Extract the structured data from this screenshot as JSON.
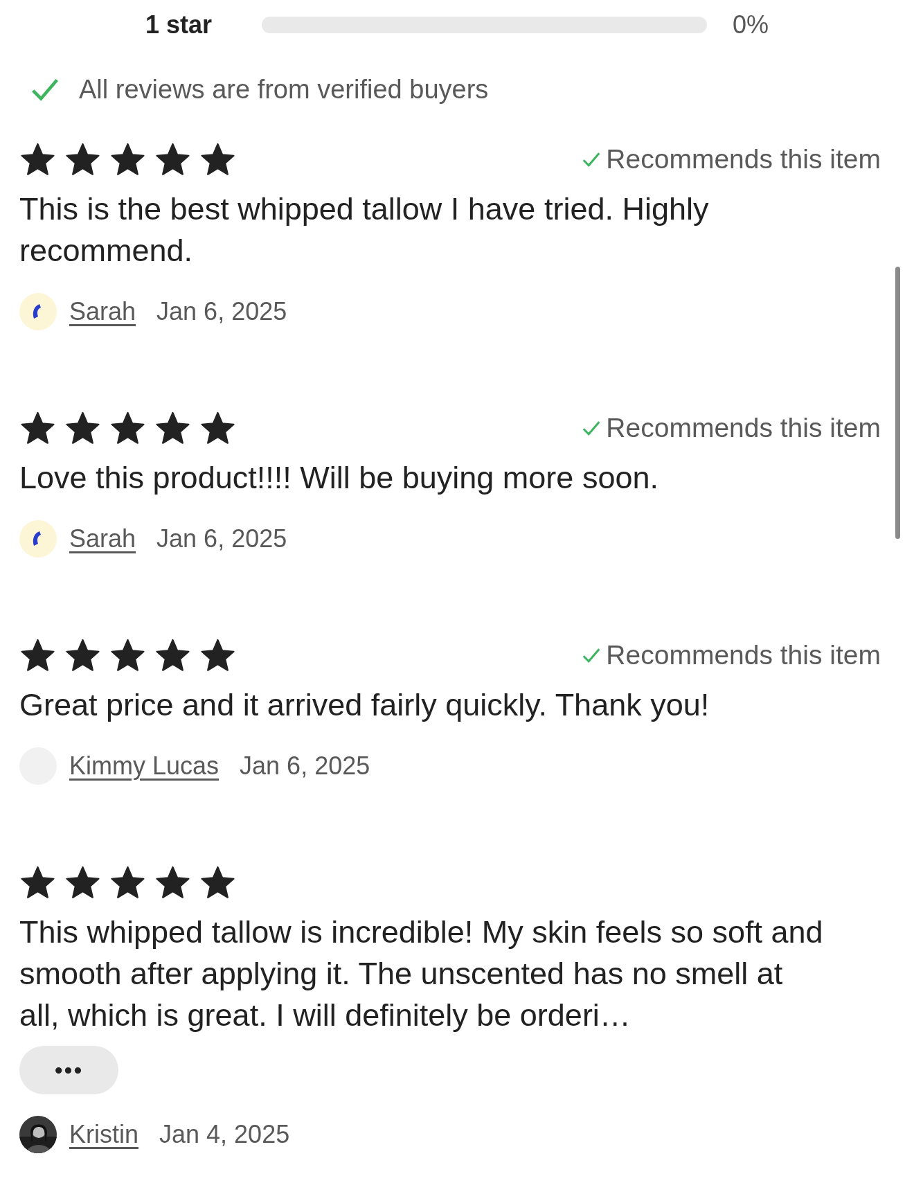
{
  "rating_breakdown": [
    {
      "label": "1 star",
      "level": 0,
      "percent": "0%"
    }
  ],
  "verified_note": "All reviews are from verified buyers",
  "reviews": [
    {
      "stars": 5,
      "recommends": "Recommends this item",
      "text": "This is the best whipped tallow I have tried. Highly recommend.",
      "author": "Sarah",
      "date": "Jan 6, 2025",
      "avatar": {
        "kind": "logo"
      }
    },
    {
      "stars": 5,
      "recommends": "Recommends this item",
      "text": "Love this product!!!! Will be buying more soon.",
      "author": "Sarah",
      "date": "Jan 6, 2025",
      "avatar": {
        "kind": "logo"
      }
    },
    {
      "stars": 5,
      "recommends": "Recommends this item",
      "text": "Great price and it arrived fairly quickly. Thank you!",
      "author": "Kimmy Lucas",
      "date": "Jan 6, 2025",
      "avatar": {
        "kind": "blank"
      }
    },
    {
      "stars": 5,
      "text": "This whipped tallow is incredible! My skin feels so soft and smooth after applying it. The unscented has no smell at all, which is great. I will definitely be orderi…",
      "more_button": "•••",
      "author": "Kristin",
      "date": "Jan 4, 2025"
    }
  ]
}
